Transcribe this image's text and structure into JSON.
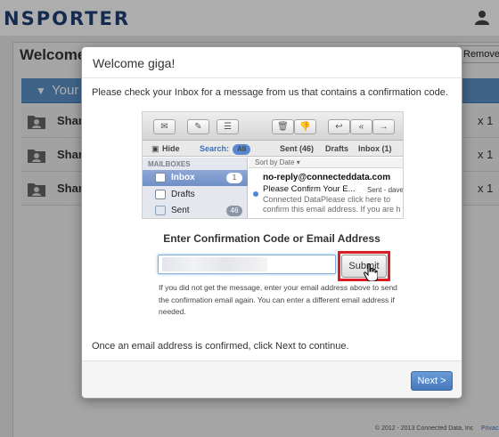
{
  "app": {
    "brand": "NSPORTER"
  },
  "background": {
    "welcome_title": "Welcome",
    "remove_button": "Remove",
    "section_title": "Your",
    "shares": [
      {
        "name": "Shar",
        "count": "x 1"
      },
      {
        "name": "Shar",
        "count": "x 1"
      },
      {
        "name": "Shar",
        "count": "x 1"
      }
    ],
    "footer": {
      "copyright": "© 2012 - 2013 Connected Data, Inc",
      "link": "Privac"
    }
  },
  "modal": {
    "title": "Welcome giga!",
    "message": "Please check your Inbox for a message from us that contains a confirmation code.",
    "mail_preview": {
      "tabs": {
        "hide": "Hide",
        "search": "Search:",
        "all": "All",
        "sent": "Sent (46)",
        "drafts": "Drafts",
        "inbox": "Inbox (1)"
      },
      "mailboxes_heading": "MAILBOXES",
      "mailboxes": [
        {
          "label": "Inbox",
          "count": "1"
        },
        {
          "label": "Drafts",
          "count": ""
        },
        {
          "label": "Sent",
          "count": "46"
        }
      ],
      "sort_label": "Sort by Date ▾",
      "from": "no-reply@connecteddata.com",
      "subject": "Please Confirm Your E...",
      "sent_by": "Sent - dave",
      "preview_line1": "Connected DataPlease click here to",
      "preview_line2": "confirm this email address. If you are h"
    },
    "code_heading": "Enter Confirmation Code or Email Address",
    "code_input_value": "",
    "submit_label": "Submit",
    "help_text": "If you did not get the message, enter your email address above to send the confirmation email again. You can enter a different email address if needed.",
    "confirm_text": "Once an email address is confirmed, click Next to continue.",
    "next_label": "Next >"
  },
  "colors": {
    "brand": "#1e3f75",
    "section_bar": "#5d93c9",
    "highlight": "#dc1c24",
    "next_button": "#4679bd"
  }
}
